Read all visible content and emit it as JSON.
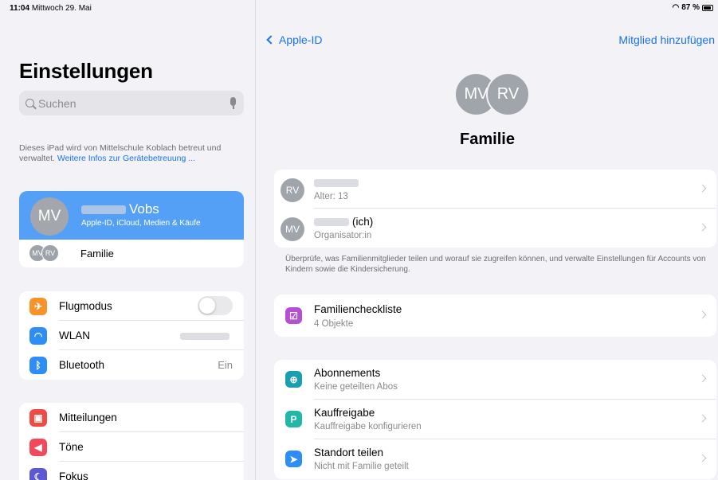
{
  "status": {
    "time": "11:04",
    "date": "Mittwoch 29. Mai",
    "battery": "87 %"
  },
  "sidebar": {
    "title": "Einstellungen",
    "search_placeholder": "Suchen",
    "managed_text": "Dieses iPad wird von Mittelschule Koblach betreut und verwaltet.",
    "managed_link": "Weitere Infos zur Gerätebetreuung ...",
    "profile": {
      "initials": "MV",
      "last_name": "Vobs",
      "subtitle": "Apple-ID, iCloud, Medien & Käufe"
    },
    "family": {
      "initials_1": "MV",
      "initials_2": "RV",
      "label": "Familie"
    },
    "connectivity": [
      {
        "label": "Flugmodus",
        "color": "#f7932a"
      },
      {
        "label": "WLAN",
        "color": "#2f8ef5"
      },
      {
        "label": "Bluetooth",
        "value": "Ein",
        "color": "#2f8ef5"
      }
    ],
    "notifications": [
      {
        "label": "Mitteilungen",
        "color": "#f24a43"
      },
      {
        "label": "Töne",
        "color": "#f24a5c"
      },
      {
        "label": "Fokus",
        "color": "#5c58d6"
      }
    ]
  },
  "main": {
    "back_label": "Apple-ID",
    "add_member": "Mitglied hinzufügen",
    "avatar_1": "MV",
    "avatar_2": "RV",
    "title": "Familie",
    "members": [
      {
        "initials": "RV",
        "subtitle": "Alter: 13"
      },
      {
        "initials": "MV",
        "name_suffix": "(ich)",
        "subtitle": "Organisator:in"
      }
    ],
    "note": "Überprüfe, was Familienmitglieder teilen und worauf sie zugreifen können, und verwalte Einstellungen für Accounts von Kindern sowie die Kindersicherung.",
    "checklist": {
      "title": "Familiencheckliste",
      "subtitle": "4 Objekte",
      "color": "#b64fd4"
    },
    "features": [
      {
        "title": "Abonnements",
        "subtitle": "Keine geteilten Abos",
        "color": "#1a9fb0"
      },
      {
        "title": "Kauffreigabe",
        "subtitle": "Kauffreigabe konfigurieren",
        "color": "#22b8a6"
      },
      {
        "title": "Standort teilen",
        "subtitle": "Nicht mit Familie geteilt",
        "color": "#2f8ef5"
      }
    ]
  }
}
